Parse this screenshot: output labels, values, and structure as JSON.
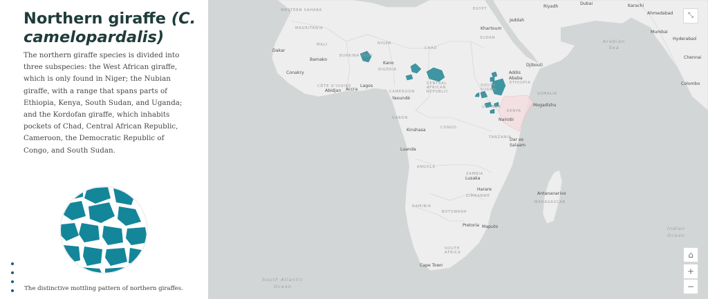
{
  "title": {
    "common": "Northern giraffe ",
    "scientific": "(C. camelopardalis)"
  },
  "description": "The northern giraffe species is divided into three subspecies: the West African giraffe, which is only found in Niger; the Nubian giraffe, with a range that spans parts of Ethiopia, Kenya, South Sudan, and Uganda; and the Kordofan giraffe, which inhabits pockets of Chad, Central African Republic, Cameroon, the Democratic Republic of Congo, and South Sudan.",
  "image_caption": "The distinctive mottling pattern of northern giraffes.",
  "colors": {
    "range": "#3f96a3",
    "pattern": "#14869a",
    "map_bg": "#d3d6d6",
    "land": "#eeeeee",
    "title": "#1f3c3a"
  },
  "map": {
    "cities": {
      "riyadh": "Riyadh",
      "dubai": "Dubai",
      "karachi": "Karachi",
      "ahmedabad": "Ahmedabad",
      "jeddah": "Jeddah",
      "mumbai": "Mumbai",
      "hyderabad": "Hyderabad",
      "chennai": "Chennai",
      "colombo": "Colombo",
      "dakar": "Dakar",
      "bamako": "Bamako",
      "conakry": "Conakry",
      "abidjan": "Abidjan",
      "accra": "Accra",
      "lagos": "Lagos",
      "kano": "Kano",
      "khartoum": "Khartoum",
      "djibouti": "Djibouti",
      "addis_ababa": "Addis Ababa",
      "mogadishu": "Mogadishu",
      "yaounde": "Yaoundé",
      "kinshasa": "Kinshasa",
      "nairobi": "Nairobi",
      "dar_es_salaam": "Dar es Salaam",
      "luanda": "Luanda",
      "lusaka": "Lusaka",
      "harare": "Harare",
      "antananarivo": "Antananarivo",
      "pretoria": "Pretoria",
      "maputo": "Maputo",
      "cape_town": "Cape Town"
    },
    "countries": {
      "western_sahara": "WESTERN SAHARA",
      "mauritania": "MAURITANIA",
      "mali": "MALI",
      "burkina_faso": "BURKINA FASO",
      "cote_divoire": "CÔTE D'IVOIRE",
      "niger": "NIGER",
      "nigeria": "NIGERIA",
      "chad": "CHAD",
      "sudan": "SUDAN",
      "egypt": "EGYPT",
      "cameroon": "CAMEROON",
      "central_african_republic": "CENTRAL AFRICAN REPUBLIC",
      "south_sudan": "SOUTH SUDAN",
      "ethiopia": "ETHIOPIA",
      "somalia": "SOMALIA",
      "uganda": "UGANDA",
      "kenya": "KENYA",
      "gabon": "GABON",
      "congo": "CONGO",
      "tanzania": "TANZANIA",
      "angola": "ANGOLA",
      "zambia": "ZAMBIA",
      "zimbabwe": "ZIMBABWE",
      "namibia": "NAMIBIA",
      "botswana": "BOTSWANA",
      "south_africa": "SOUTH AFRICA",
      "madagascar": "MADAGASCAR"
    },
    "oceans": {
      "arabian_sea": "Arabian Sea",
      "indian_ocean": "Indian Ocean",
      "south_atlantic_ocean": "South Atlantic Ocean"
    }
  },
  "controls": {
    "expand": "⤡",
    "home": "⌂",
    "zoom_in": "+",
    "zoom_out": "−"
  }
}
